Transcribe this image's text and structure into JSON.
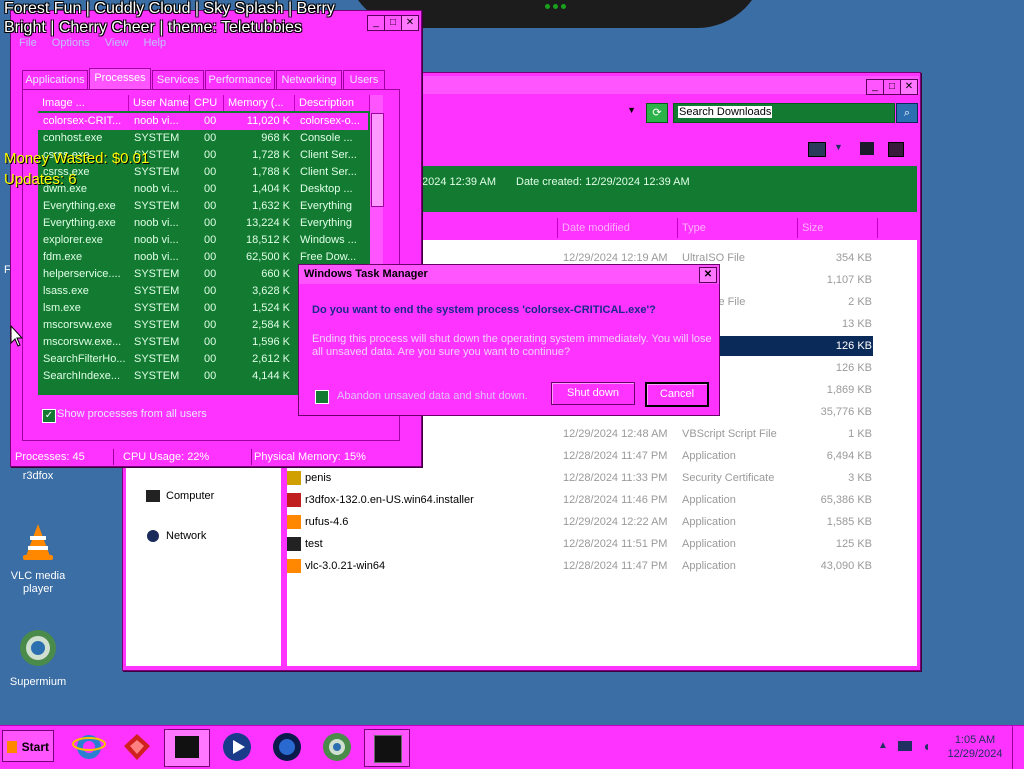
{
  "overlay": {
    "line1": "Forest Fun | Cuddly Cloud | Sky Splash | Berry",
    "line2": "Bright | Cherry Cheer | theme: Teletubbies",
    "money": "Money Wasted: $0.01",
    "updates": "Updates: 6"
  },
  "desktop_icons": [
    {
      "label": "r3dfox"
    },
    {
      "label": "VLC media player"
    },
    {
      "label": "Supermium"
    }
  ],
  "task_manager": {
    "menu": [
      "File",
      "Options",
      "View",
      "Help"
    ],
    "tabs": [
      "Applications",
      "Processes",
      "Services",
      "Performance",
      "Networking",
      "Users"
    ],
    "columns": [
      "Image ...",
      "User Name",
      "CPU",
      "Memory (...",
      "Description"
    ],
    "rows": [
      {
        "image": "colorsex-CRIT...",
        "user": "noob vi...",
        "cpu": "00",
        "mem": "11,020 K",
        "desc": "colorsex-o..."
      },
      {
        "image": "conhost.exe",
        "user": "SYSTEM",
        "cpu": "00",
        "mem": "968 K",
        "desc": "Console ..."
      },
      {
        "image": "csrss.exe",
        "user": "SYSTEM",
        "cpu": "00",
        "mem": "1,728 K",
        "desc": "Client Ser..."
      },
      {
        "image": "csrss.exe",
        "user": "SYSTEM",
        "cpu": "00",
        "mem": "1,788 K",
        "desc": "Client Ser..."
      },
      {
        "image": "dwm.exe",
        "user": "noob vi...",
        "cpu": "00",
        "mem": "1,404 K",
        "desc": "Desktop ..."
      },
      {
        "image": "Everything.exe",
        "user": "SYSTEM",
        "cpu": "00",
        "mem": "1,632 K",
        "desc": "Everything"
      },
      {
        "image": "Everything.exe",
        "user": "noob vi...",
        "cpu": "00",
        "mem": "13,224 K",
        "desc": "Everything"
      },
      {
        "image": "explorer.exe",
        "user": "noob vi...",
        "cpu": "00",
        "mem": "18,512 K",
        "desc": "Windows ..."
      },
      {
        "image": "fdm.exe",
        "user": "noob vi...",
        "cpu": "00",
        "mem": "62,500 K",
        "desc": "Free Dow..."
      },
      {
        "image": "helperservice....",
        "user": "SYSTEM",
        "cpu": "00",
        "mem": "660 K",
        "desc": ""
      },
      {
        "image": "lsass.exe",
        "user": "SYSTEM",
        "cpu": "00",
        "mem": "3,628 K",
        "desc": ""
      },
      {
        "image": "lsm.exe",
        "user": "SYSTEM",
        "cpu": "00",
        "mem": "1,524 K",
        "desc": ""
      },
      {
        "image": "mscorsvw.exe",
        "user": "SYSTEM",
        "cpu": "00",
        "mem": "2,584 K",
        "desc": ""
      },
      {
        "image": "mscorsvw.exe...",
        "user": "SYSTEM",
        "cpu": "00",
        "mem": "1,596 K",
        "desc": ""
      },
      {
        "image": "SearchFilterHo...",
        "user": "SYSTEM",
        "cpu": "00",
        "mem": "2,612 K",
        "desc": ""
      },
      {
        "image": "SearchIndexe...",
        "user": "SYSTEM",
        "cpu": "00",
        "mem": "4,144 K",
        "desc": ""
      }
    ],
    "show_all_label": "Show processes from all users",
    "status": {
      "processes": "Processes: 45",
      "cpu": "CPU Usage: 22%",
      "memory": "Physical Memory: 15%"
    }
  },
  "dialog": {
    "title": "Windows Task Manager",
    "question": "Do you want to end the system process 'colorsex-CRITICAL.exe'?",
    "body": "Ending this process will shut down the operating system immediately.  You will lose all unsaved data.  Are you sure you want to continue?",
    "checkbox_label": "Abandon unsaved data and shut down.",
    "shutdown": "Shut down",
    "cancel": "Cancel"
  },
  "explorer": {
    "search_placeholder": "Search Downloads",
    "info_modified": "2024 12:39 AM",
    "info_created": "Date created: 12/29/2024 12:39 AM",
    "columns": [
      "Date modified",
      "Type",
      "Size"
    ],
    "nav": [
      "Computer",
      "Network"
    ],
    "files": [
      {
        "name": "",
        "date": "12/29/2024 12:19 AM",
        "type": "UltraISO File",
        "size": "354 KB"
      },
      {
        "name": "",
        "date": "",
        "type": "",
        "size": "1,107 KB"
      },
      {
        "name": "",
        "date": "",
        "type": "s Theme File",
        "size": "2 KB"
      },
      {
        "name": "",
        "date": "",
        "type": "ation",
        "size": "13 KB"
      },
      {
        "name": "",
        "date": "",
        "type": "ation",
        "size": "126 KB",
        "selected": true
      },
      {
        "name": "",
        "date": "",
        "type": "ation",
        "size": "126 KB"
      },
      {
        "name": "",
        "date": "",
        "type": "ation",
        "size": "1,869 KB"
      },
      {
        "name": "",
        "date": "",
        "type": "ation",
        "size": "35,776 KB"
      },
      {
        "name": "",
        "date": "12/29/2024 12:48 AM",
        "type": "VBScript Script File",
        "size": "1 KB"
      },
      {
        "name": "64",
        "date": "12/28/2024 11:47 PM",
        "type": "Application",
        "size": "6,494 KB"
      },
      {
        "name": "penis",
        "date": "12/28/2024 11:33 PM",
        "type": "Security Certificate",
        "size": "3 KB"
      },
      {
        "name": "r3dfox-132.0.en-US.win64.installer",
        "date": "12/28/2024 11:46 PM",
        "type": "Application",
        "size": "65,386 KB"
      },
      {
        "name": "rufus-4.6",
        "date": "12/29/2024 12:22 AM",
        "type": "Application",
        "size": "1,585 KB"
      },
      {
        "name": "test",
        "date": "12/28/2024 11:51 PM",
        "type": "Application",
        "size": "125 KB"
      },
      {
        "name": "vlc-3.0.21-win64",
        "date": "12/28/2024 11:47 PM",
        "type": "Application",
        "size": "43,090 KB"
      }
    ]
  },
  "taskbar": {
    "start": "Start",
    "time": "1:05 AM",
    "date": "12/29/2024"
  },
  "colors": {
    "window": "#ff33ff",
    "grid": "#137a32",
    "desktop": "#3a6ea5"
  }
}
